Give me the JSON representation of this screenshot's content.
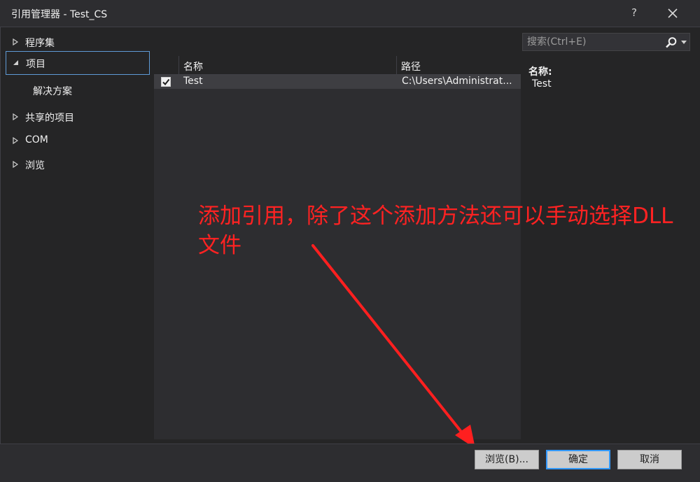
{
  "window": {
    "title": "引用管理器 - Test_CS",
    "help_label": "?",
    "close_icon": "close-icon"
  },
  "nav": {
    "items": [
      {
        "label": "程序集",
        "expanded": false
      },
      {
        "label": "项目",
        "expanded": true,
        "selected": true
      },
      {
        "label": "解决方案",
        "child": true
      },
      {
        "label": "共享的项目",
        "expanded": false
      },
      {
        "label": "COM",
        "expanded": false
      },
      {
        "label": "浏览",
        "expanded": false
      }
    ]
  },
  "list": {
    "columns": {
      "name": "名称",
      "path": "路径"
    },
    "rows": [
      {
        "checked": true,
        "name": "Test",
        "path": "C:\\Users\\Administrat..."
      }
    ]
  },
  "search": {
    "placeholder": "搜索(Ctrl+E)",
    "icon": "search-icon"
  },
  "details": {
    "name_label": "名称:",
    "name_value": "Test"
  },
  "annotation": {
    "text": "添加引用，除了这个添加方法还可以手动选择DLL文件",
    "color": "#ff2222"
  },
  "buttons": {
    "browse": "浏览(B)...",
    "ok": "确定",
    "cancel": "取消"
  },
  "colors": {
    "background": "#252526",
    "titlebar": "#2d2d30",
    "accent_border": "#3399ff"
  }
}
